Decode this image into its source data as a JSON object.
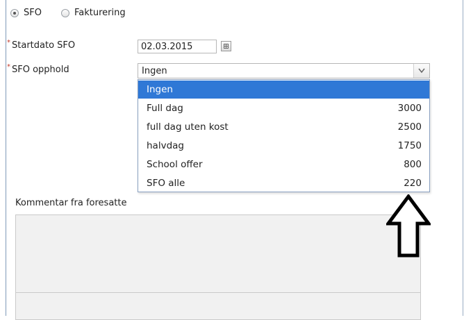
{
  "radio": {
    "options": [
      {
        "label": "SFO",
        "checked": true
      },
      {
        "label": "Fakturering",
        "checked": false
      }
    ]
  },
  "fields": {
    "start_date_label": "Startdato SFO",
    "start_date_value": "02.03.2015",
    "stay_label": "SFO opphold",
    "stay_value": "Ingen",
    "required_marker": "*"
  },
  "dropdown": {
    "options": [
      {
        "label": "Ingen",
        "price": ""
      },
      {
        "label": "Full dag",
        "price": "3000"
      },
      {
        "label": "full dag uten kost",
        "price": "2500"
      },
      {
        "label": "halvdag",
        "price": "1750"
      },
      {
        "label": "School offer",
        "price": "800"
      },
      {
        "label": "SFO alle",
        "price": "220"
      }
    ],
    "selected_index": 0
  },
  "comment": {
    "label": "Kommentar fra foresatte",
    "value": ""
  },
  "colors": {
    "selection": "#2f78d6",
    "required": "#c0392b"
  },
  "icons": {
    "calendar": "calendar-icon",
    "dropdown": "chevron-down-icon",
    "annotation": "up-arrow-icon"
  }
}
